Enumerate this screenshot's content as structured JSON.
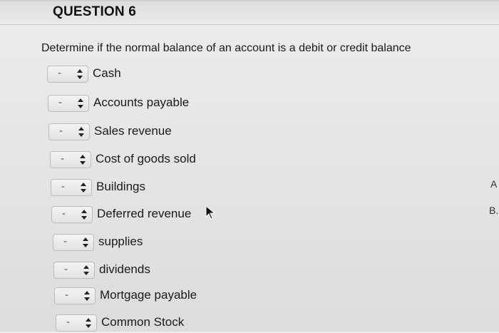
{
  "question": {
    "title": "QUESTION 6",
    "prompt": "Determine if the normal balance of an account is a debit or credit balance"
  },
  "items": [
    {
      "select_value": "-",
      "label": "Cash"
    },
    {
      "select_value": "-",
      "label": "Accounts payable"
    },
    {
      "select_value": "-",
      "label": "Sales revenue"
    },
    {
      "select_value": "-",
      "label": "Cost of goods sold"
    },
    {
      "select_value": "-",
      "label": "Buildings"
    },
    {
      "select_value": "-",
      "label": "Deferred revenue"
    },
    {
      "select_value": "-",
      "label": "supplies"
    },
    {
      "select_value": "-",
      "label": "dividends"
    },
    {
      "select_value": "-",
      "label": "Mortgage payable"
    },
    {
      "select_value": "-",
      "label": "Common Stock"
    }
  ],
  "side_letters": [
    "A",
    "B."
  ],
  "icons": {
    "select_arrows": "up-down-chevron-icon",
    "cursor": "mouse-pointer-icon"
  }
}
